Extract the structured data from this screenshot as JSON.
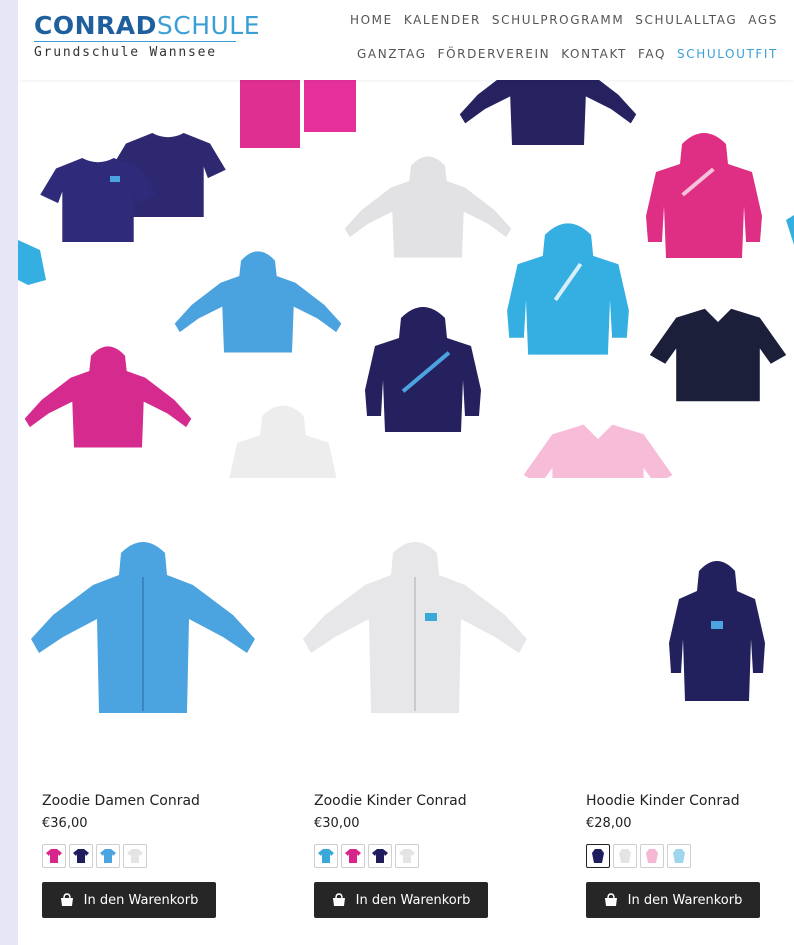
{
  "header": {
    "logo": {
      "bold": "CONRAD",
      "light": "SCHULE",
      "subtitle": "Grundschule Wannsee"
    },
    "nav_row1": [
      "HOME",
      "KALENDER",
      "SCHULPROGRAMM",
      "SCHULALLTAG",
      "AGS"
    ],
    "nav_row2": [
      "GANZTAG",
      "FÖRDERVEREIN",
      "KONTAKT",
      "FAQ",
      "SCHULOUTFIT"
    ],
    "active_item": "SCHULOUTFIT",
    "accent_color": "#3b9fd5",
    "logo_dark_color": "#1f5f9e"
  },
  "hero": {
    "items": [
      "navy-tshirt-icon",
      "pink-tshirt-icon",
      "navy-hoodie-icon",
      "pink-hoodie-icon",
      "white-zoodie-icon",
      "light-blue-zoodie-icon",
      "turquoise-hoodie-icon",
      "pink-zoodie-icon",
      "navy-hoodie-icon",
      "navy-polo-icon",
      "white-hoodie-icon",
      "pink-polo-icon"
    ]
  },
  "products": [
    {
      "title": "Zoodie Damen Conrad",
      "price": "€36,00",
      "image": "light-blue-zoodie-icon",
      "image_color": "#4ba3df",
      "swatches": [
        "#d6268c",
        "#1f1d5e",
        "#4ba3df",
        "#eeeeee"
      ],
      "selected_swatch": -1,
      "button": "In den Warenkorb"
    },
    {
      "title": "Zoodie Kinder Conrad",
      "price": "€30,00",
      "image": "white-zoodie-icon",
      "image_color": "#e7e7e9",
      "swatches": [
        "#3aa8d8",
        "#d6268c",
        "#1f1d5e",
        "#eeeeee"
      ],
      "selected_swatch": -1,
      "button": "In den Warenkorb"
    },
    {
      "title": "Hoodie Kinder Conrad",
      "price": "€28,00",
      "image": "navy-hoodie-icon",
      "image_color": "#23205e",
      "swatches": [
        "#1f1d5e",
        "#eeeeee",
        "#f5b7d3",
        "#9fd6ee"
      ],
      "selected_swatch": 0,
      "button": "In den Warenkorb"
    }
  ]
}
